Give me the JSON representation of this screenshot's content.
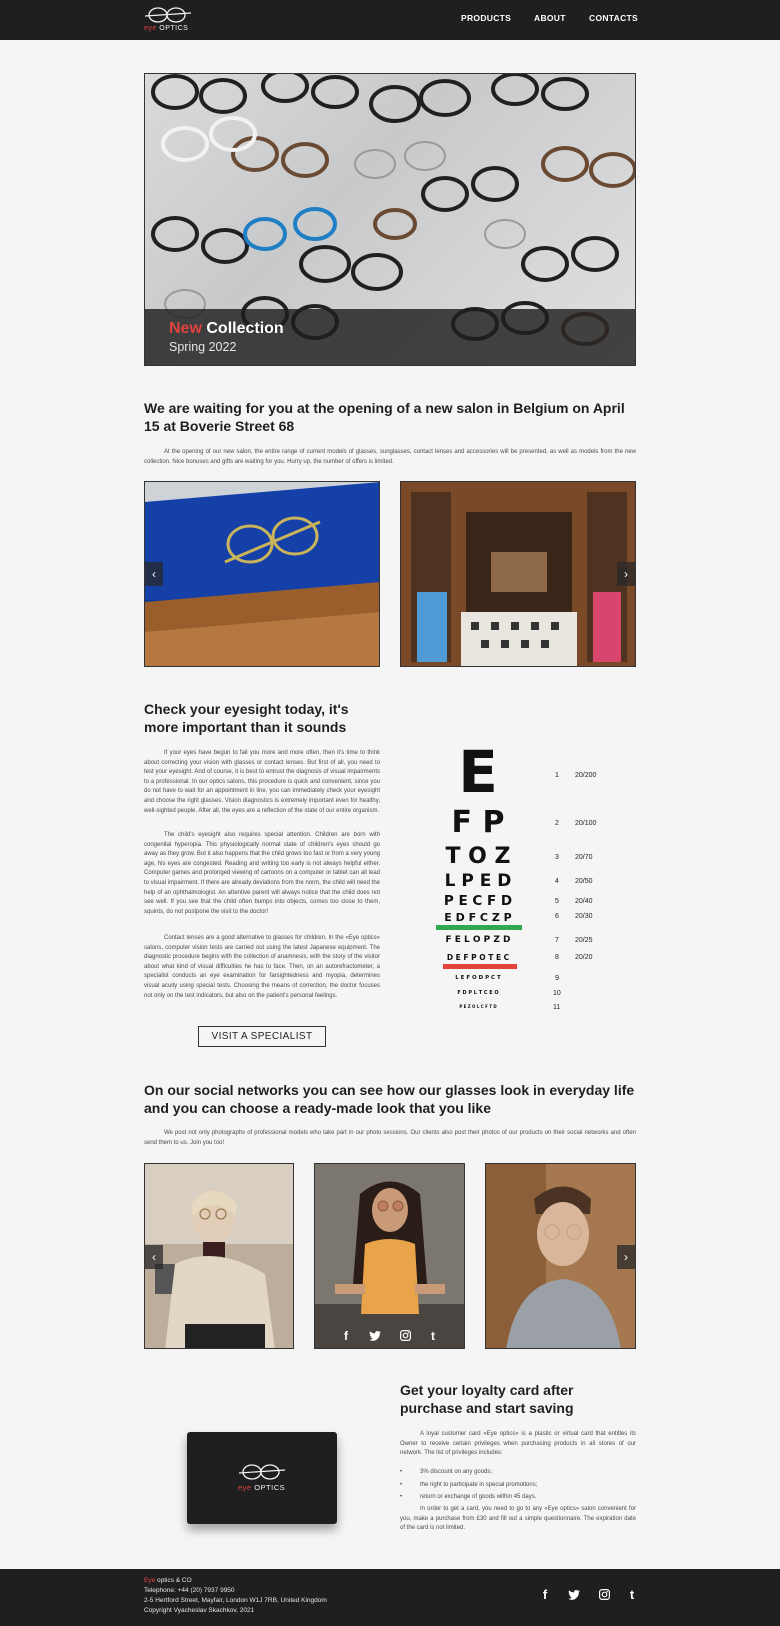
{
  "header": {
    "logo": {
      "eye": "eye",
      "optics": "OPTICS"
    },
    "nav": [
      "PRODUCTS",
      "ABOUT",
      "CONTACTS"
    ]
  },
  "hero": {
    "title_accent": "New",
    "title_rest": "Collection",
    "subtitle": "Spring 2022"
  },
  "opening": {
    "heading": "We are waiting for you at the opening of a new salon in Belgium on April 15 at Boverie Street 68",
    "text": "At the opening of our new salon, the entire range of current models of glasses, sunglasses, contact lenses and accessories will be presented, as well as models from the new collection. Nice bonuses and gifts are waiting for you. Hurry up, the number of offers is limited.",
    "prev_icon": "chevron-left-icon",
    "next_icon": "chevron-right-icon"
  },
  "eyesight": {
    "heading": "Check your eyesight today, it's more important than it sounds",
    "p1": "If your eyes have begun to fail you more and more often, then it's time to think about correcting your vision with glasses or contact lenses. But first of all, you need to test your eyesight. And of course, it is best to entrust the diagnosis of visual impairments to a professional. In our optics salons, this procedure is quick and convenient, since you do not have to wait for an appointment in line, you can immediately check your eyesight and choose the right glasses. Vision diagnostics is extremely important even for healthy, well-sighted people. After all, the eyes are a reflection of the state of our entire organism.",
    "p2": "The child's eyesight also requires special attention. Children are born with congenital hyperopia. This physiologically normal state of children's eyes should go away as they grow. But it also happens that the child grows too fast or from a very young age, his eyes are congested. Reading and writing too early is not always helpful either. Computer games and prolonged viewing of cartoons on a computer or tablet can all lead to visual impairment. If there are already deviations from the norm, the child will need the help of an ophthalmologist. An attentive parent will always notice that the child does not see well. If you see that the child often bumps into objects, comes too close to them, squints, do not postpone the visit to the doctor!",
    "p3": "Contact lenses are a good alternative to glasses for children. In the «Eye optics» salons, computer vision tests are carried out using the latest Japanese equipment. The diagnostic procedure begins with the collection of anamnesis, with the story of the visitor about what kind of visual difficulties he has to face. Then, on an autorefractometer, a specialist conducts an eye examination for farsightedness and myopia, determines visual acuity using special tests. Choosing the means of correction, the doctor focuses not only on the test indicators, but also on the patient's personal feelings.",
    "button": "VISIT A SPECIALIST",
    "chart": {
      "rows": [
        {
          "letters": "E",
          "num": "1",
          "acuity": "20/200"
        },
        {
          "letters": "F P",
          "num": "2",
          "acuity": "20/100"
        },
        {
          "letters": "T O Z",
          "num": "3",
          "acuity": "20/70"
        },
        {
          "letters": "L P E D",
          "num": "4",
          "acuity": "20/50"
        },
        {
          "letters": "P E C F D",
          "num": "5",
          "acuity": "20/40"
        },
        {
          "letters": "E D F C Z P",
          "num": "6",
          "acuity": "20/30"
        },
        {
          "letters": "F E L O P Z D",
          "num": "7",
          "acuity": "20/25"
        },
        {
          "letters": "D E F P O T E C",
          "num": "8",
          "acuity": "20/20"
        },
        {
          "letters": "L E F O D P C T",
          "num": "9",
          "acuity": ""
        },
        {
          "letters": "F D P L T C E O",
          "num": "10",
          "acuity": ""
        },
        {
          "letters": "P E Z O L C F T D",
          "num": "11",
          "acuity": ""
        }
      ],
      "green": "#2fa84f",
      "red": "#e2423c"
    }
  },
  "social": {
    "heading": "On our social networks you can see how our glasses look in everyday life and you can choose a ready-made look that you like",
    "text": "We post not only photographs of professional models who take part in our photo sessions. Our clients also post their photos of our products on their social networks and often send them to us. Join you too!",
    "icons": [
      "facebook-icon",
      "twitter-icon",
      "instagram-icon",
      "tumblr-icon"
    ]
  },
  "loyalty": {
    "heading": "Get your loyalty card after purchase and start saving",
    "intro": "A loyal customer card «Eye optics» is a plastic or virtual card that entitles its Owner to receive certain privileges when purchasing products in all stores of our network. The list of privileges includes:",
    "items": [
      "3% discount on any goods;",
      "the right to participate in special promotions;",
      "return or exchange of goods within 45 days."
    ],
    "outro": "In order to get a card, you need to go to any «Eye optics» salon convenient for you, make a purchase from £30 and fill out a simple questionnaire. The expiration date of the card is not limited.",
    "card_logo": {
      "eye": "eye",
      "optics": "OPTICS"
    }
  },
  "footer": {
    "brand_eye": "Eye",
    "brand_rest": " optics & CO",
    "phone": "Telephone: +44 (20) 7937 9950",
    "address": "2-5 Hertford Street, Mayfair, London W1J 7RB, United Kingdom",
    "copyright": "Copyright Vyacheslav Skachkov, 2021"
  },
  "colors": {
    "accent": "#e2423c",
    "dark": "#1f1f21",
    "background": "#f5f5f5"
  }
}
